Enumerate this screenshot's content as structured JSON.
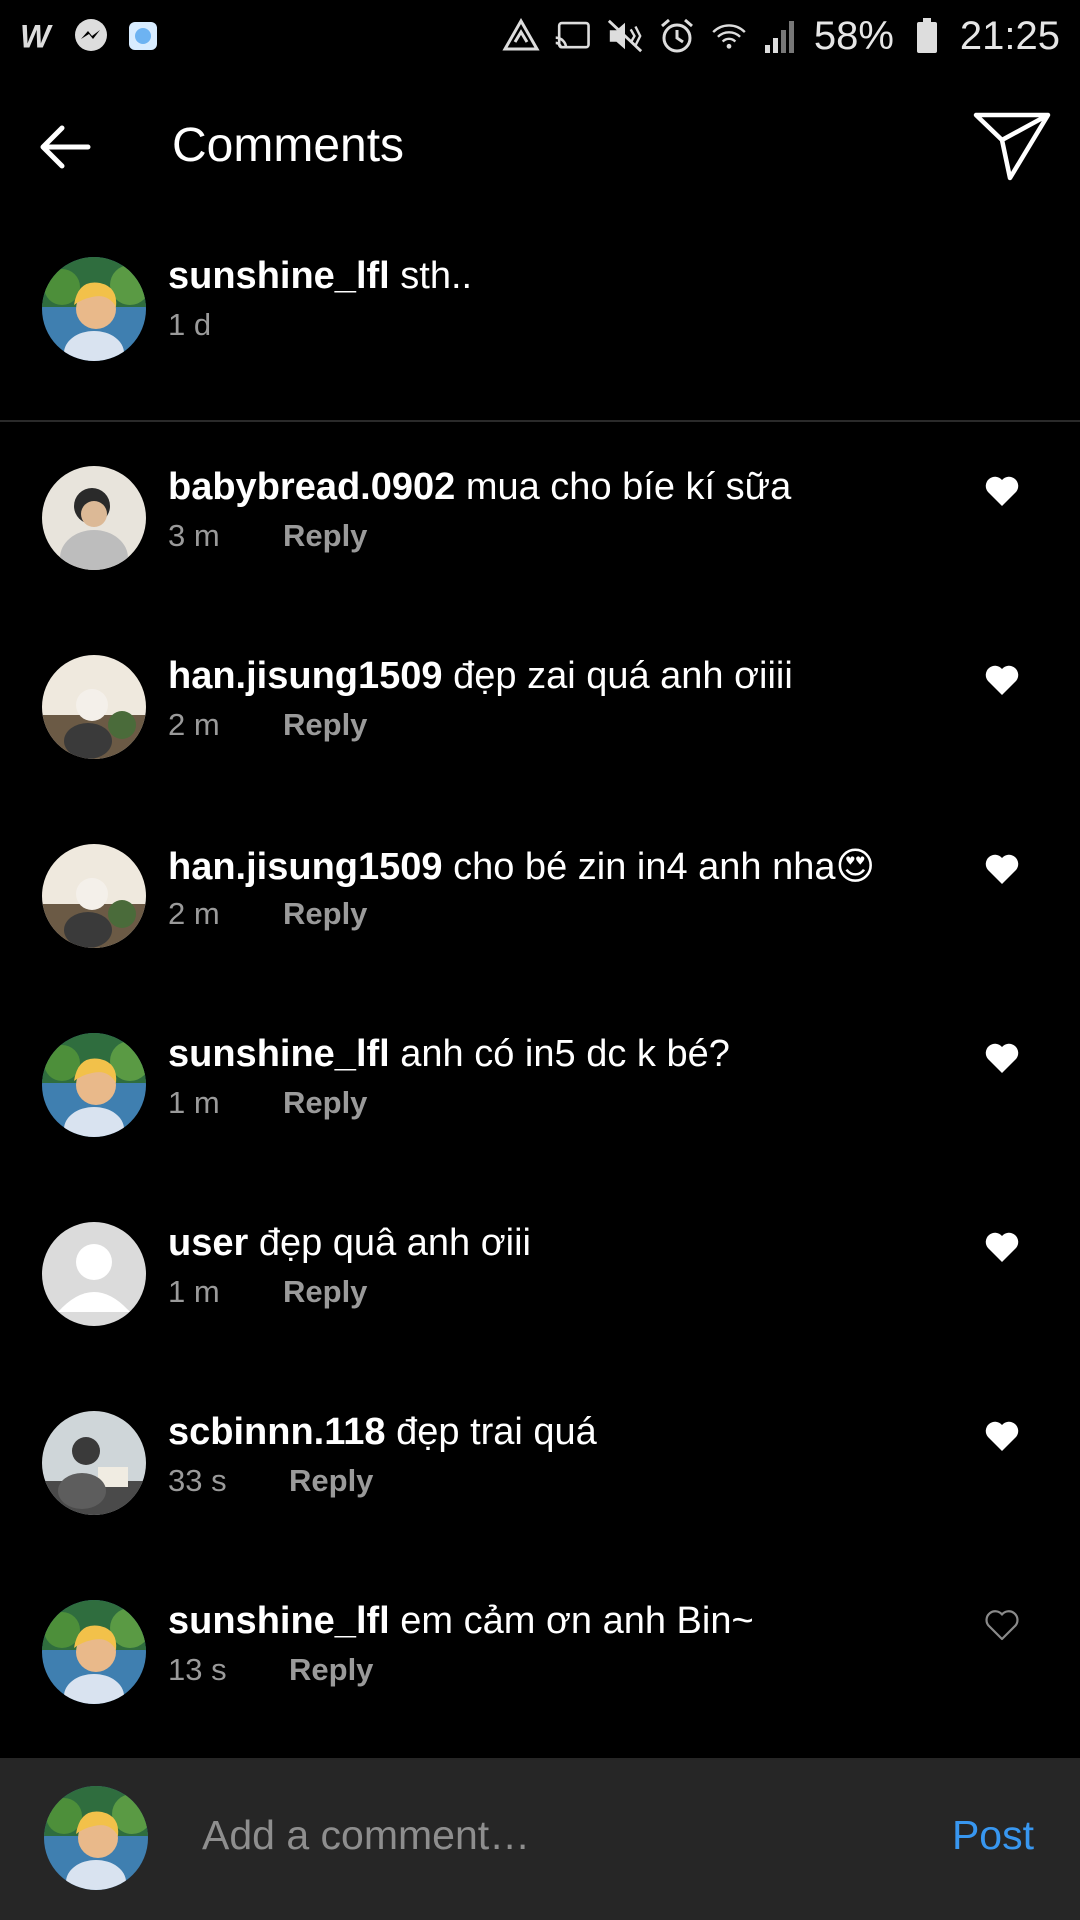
{
  "status_bar": {
    "battery": "58%",
    "time": "21:25"
  },
  "header": {
    "title": "Comments"
  },
  "caption": {
    "username": "sunshine_lfl",
    "text": "sth..",
    "time": "1 d"
  },
  "comments": [
    {
      "username": "babybread.0902",
      "text": "mua cho bíe kí sữa",
      "time": "3 m",
      "reply": "Reply",
      "liked": true
    },
    {
      "username": "han.jisung1509",
      "text": "đẹp zai quá anh ơiiii",
      "time": "2 m",
      "reply": "Reply",
      "liked": true
    },
    {
      "username": "han.jisung1509",
      "text": "cho bé zin in4 anh nha😍",
      "time": "2 m",
      "reply": "Reply",
      "liked": true
    },
    {
      "username": "sunshine_lfl",
      "text": "anh có in5 dc k bé?",
      "time": "1 m",
      "reply": "Reply",
      "liked": true
    },
    {
      "username": "user",
      "text": "đẹp quâ anh ơiii",
      "time": "1 m",
      "reply": "Reply",
      "liked": true
    },
    {
      "username": "scbinnn.118",
      "text": "đẹp trai quá",
      "time": "33 s",
      "reply": "Reply",
      "liked": true
    },
    {
      "username": "sunshine_lfl",
      "text": "em cảm ơn anh Bin~",
      "time": "13 s",
      "reply": "Reply",
      "liked": false
    }
  ],
  "composer": {
    "placeholder": "Add a comment…",
    "post_label": "Post"
  },
  "colors": {
    "background": "#000000",
    "composer_bg": "#262626",
    "accent": "#3897f0",
    "muted": "#9a9a9a"
  }
}
